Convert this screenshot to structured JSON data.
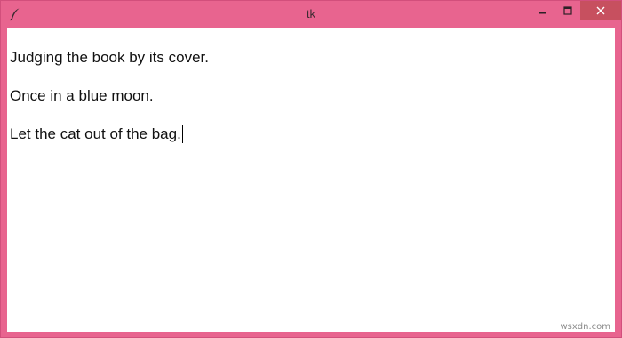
{
  "window": {
    "title": "tk",
    "app_icon": "feather-icon",
    "controls": {
      "minimize_icon": "minimize-icon",
      "maximize_icon": "maximize-icon",
      "close_icon": "close-icon",
      "close_color": "#c7505f"
    },
    "frame_color": "#e8648f"
  },
  "text_widget": {
    "lines": [
      "Judging the book by its cover.",
      "Once in a blue moon.",
      "Let the cat out of the bag."
    ]
  },
  "watermark": "wsxdn.com"
}
